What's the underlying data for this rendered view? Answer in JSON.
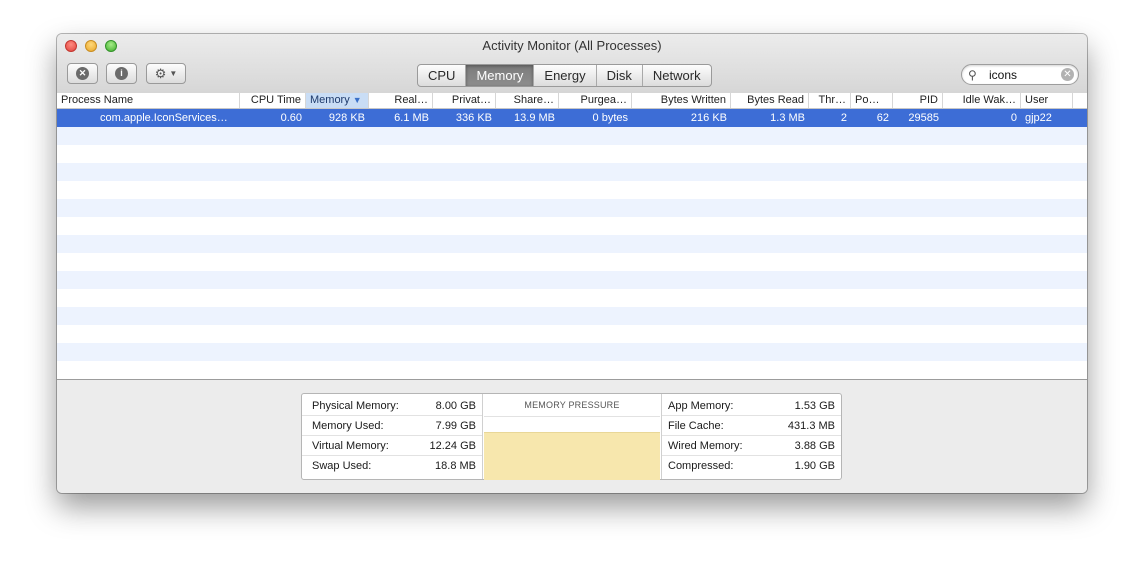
{
  "window": {
    "title": "Activity Monitor (All Processes)"
  },
  "toolbar": {
    "tabs": [
      {
        "label": "CPU",
        "active": false
      },
      {
        "label": "Memory",
        "active": true
      },
      {
        "label": "Energy",
        "active": false
      },
      {
        "label": "Disk",
        "active": false
      },
      {
        "label": "Network",
        "active": false
      }
    ],
    "search": {
      "value": "icons"
    },
    "icons": {
      "stop": "stop-process-icon",
      "info": "info-icon",
      "gear": "gear-icon"
    }
  },
  "table": {
    "columns": [
      "Process Name",
      "CPU Time",
      "Memory",
      "Real…",
      "Privat…",
      "Share…",
      "Purgea…",
      "Bytes Written",
      "Bytes Read",
      "Thr…",
      "Po…",
      "PID",
      "Idle Wak…",
      "User"
    ],
    "sorted_column": "Memory",
    "sort_direction": "descending",
    "rows": [
      [
        "com.apple.IconServices…",
        "0.60",
        "928 KB",
        "6.1 MB",
        "336 KB",
        "13.9 MB",
        "0 bytes",
        "216 KB",
        "1.3 MB",
        "2",
        "62",
        "29585",
        "0",
        "gjp22"
      ]
    ],
    "selected_row": 0
  },
  "memory_stats": {
    "left": [
      {
        "label": "Physical Memory:",
        "value": "8.00 GB"
      },
      {
        "label": "Memory Used:",
        "value": "7.99 GB"
      },
      {
        "label": "Virtual Memory:",
        "value": "12.24 GB"
      },
      {
        "label": "Swap Used:",
        "value": "18.8 MB"
      }
    ],
    "pressure_title": "MEMORY PRESSURE",
    "right": [
      {
        "label": "App Memory:",
        "value": "1.53 GB"
      },
      {
        "label": "File Cache:",
        "value": "431.3 MB"
      },
      {
        "label": "Wired Memory:",
        "value": "3.88 GB"
      },
      {
        "label": "Compressed:",
        "value": "1.90 GB"
      }
    ]
  },
  "colors": {
    "selection": "#3d6dd6",
    "stripe": "#edf3fe",
    "pressure_fill": "#f7e7ad",
    "sorted_header": "#c9ddf5"
  }
}
